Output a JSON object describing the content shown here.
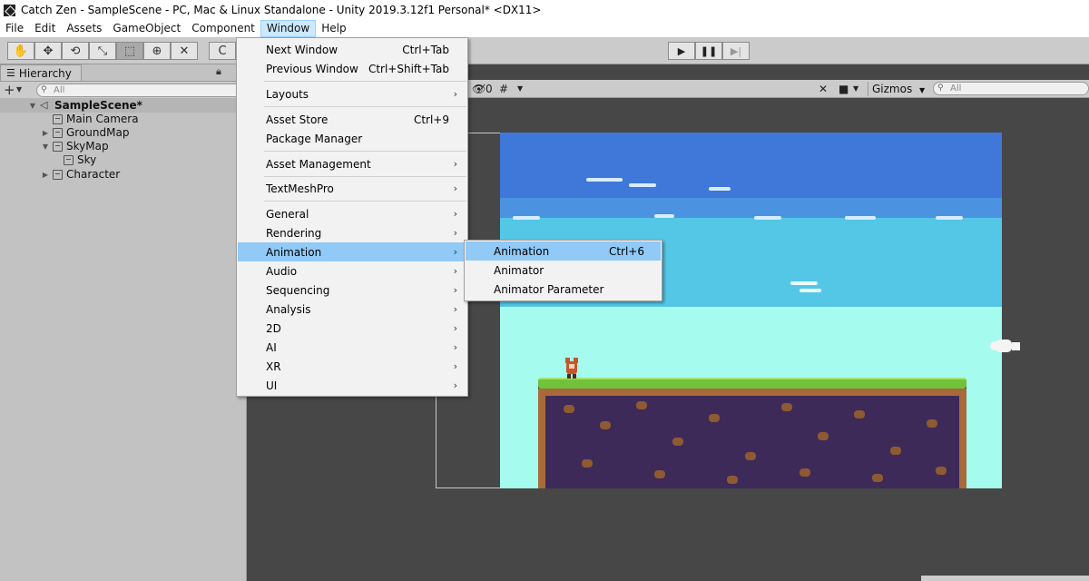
{
  "window": {
    "title": "Catch Zen - SampleScene - PC, Mac & Linux Standalone - Unity 2019.3.12f1 Personal* <DX11>"
  },
  "menubar": {
    "items": [
      "File",
      "Edit",
      "Assets",
      "GameObject",
      "Component",
      "Window",
      "Help"
    ],
    "active": "Window"
  },
  "toolbar": {
    "tools": [
      {
        "icon": "hand-tool-icon",
        "glyph": "✋"
      },
      {
        "icon": "move-tool-icon",
        "glyph": "✥"
      },
      {
        "icon": "rotate-tool-icon",
        "glyph": "⟲"
      },
      {
        "icon": "scale-tool-icon",
        "glyph": "⤡"
      },
      {
        "icon": "rect-tool-icon",
        "glyph": "⬚"
      },
      {
        "icon": "transform-tool-icon",
        "glyph": "⊕"
      },
      {
        "icon": "custom-tool-icon",
        "glyph": "✕"
      }
    ],
    "pivot_label": "C",
    "play_glyph": "▶",
    "pause_glyph": "❚❚",
    "step_glyph": "▶|"
  },
  "hierarchy": {
    "tab_label": "Hierarchy",
    "add_glyph": "+",
    "search_placeholder": "All",
    "scene": "SampleScene*",
    "items": [
      {
        "label": "Main Camera",
        "indent": 1,
        "expander": ""
      },
      {
        "label": "GroundMap",
        "indent": 1,
        "expander": "▶"
      },
      {
        "label": "SkyMap",
        "indent": 1,
        "expander": "▼"
      },
      {
        "label": "Sky",
        "indent": 2,
        "expander": ""
      },
      {
        "label": "Character",
        "indent": 1,
        "expander": "▶"
      }
    ]
  },
  "scene_toolbar": {
    "hidden_count": "0",
    "gizmos_label": "Gizmos",
    "search_placeholder": "All"
  },
  "window_menu": {
    "items": [
      {
        "label": "Next Window",
        "shortcut": "Ctrl+Tab",
        "submenu": false
      },
      {
        "label": "Previous Window",
        "shortcut": "Ctrl+Shift+Tab",
        "submenu": false
      },
      {
        "label": "Layouts",
        "shortcut": "",
        "submenu": true
      },
      {
        "label": "Asset Store",
        "shortcut": "Ctrl+9",
        "submenu": false
      },
      {
        "label": "Package Manager",
        "shortcut": "",
        "submenu": false
      },
      {
        "label": "Asset Management",
        "shortcut": "",
        "submenu": true
      },
      {
        "label": "TextMeshPro",
        "shortcut": "",
        "submenu": true
      },
      {
        "label": "General",
        "shortcut": "",
        "submenu": true
      },
      {
        "label": "Rendering",
        "shortcut": "",
        "submenu": true
      },
      {
        "label": "Animation",
        "shortcut": "",
        "submenu": true
      },
      {
        "label": "Audio",
        "shortcut": "",
        "submenu": true
      },
      {
        "label": "Sequencing",
        "shortcut": "",
        "submenu": true
      },
      {
        "label": "Analysis",
        "shortcut": "",
        "submenu": true
      },
      {
        "label": "2D",
        "shortcut": "",
        "submenu": true
      },
      {
        "label": "AI",
        "shortcut": "",
        "submenu": true
      },
      {
        "label": "XR",
        "shortcut": "",
        "submenu": true
      },
      {
        "label": "UI",
        "shortcut": "",
        "submenu": true
      }
    ],
    "highlighted": "Animation"
  },
  "animation_submenu": {
    "items": [
      {
        "label": "Animation",
        "shortcut": "Ctrl+6"
      },
      {
        "label": "Animator",
        "shortcut": ""
      },
      {
        "label": "Animator Parameter",
        "shortcut": ""
      }
    ],
    "highlighted": "Animation"
  },
  "colors": {
    "menu_highlight": "#91c9f7",
    "menubar_active": "#cce8ff",
    "sky_top": "#3f78d9",
    "sky_mid": "#54c7e6",
    "sky_low": "#a5fbee",
    "grass": "#6fc23a",
    "soil": "#3d2a58"
  }
}
